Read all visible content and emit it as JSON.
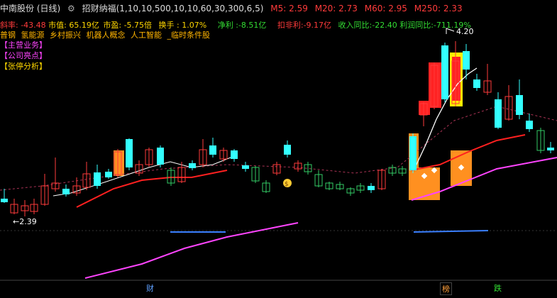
{
  "header": {
    "stock": "中南股份 (日线)",
    "gear_icon": "gear-icon",
    "indicator": "招财纳福(1,10,10,500,10,10,60,30,300,6,5)",
    "ma": [
      {
        "label": "M5: 2.59",
        "color": "#ff3b3b"
      },
      {
        "label": "M20: 2.73",
        "color": "#ff3b3b"
      },
      {
        "label": "M60: 2.95",
        "color": "#ff3b3b"
      },
      {
        "label": "M250: 2.33",
        "color": "#ff3b3b"
      }
    ]
  },
  "stats": [
    {
      "text": "斜率: -43.48",
      "color": "#ff3b3b"
    },
    {
      "text": "市值: 65.19亿",
      "color": "#ffd700"
    },
    {
      "text": "市盈: -5.75倍",
      "color": "#ffd700"
    },
    {
      "text": "换手 : 1.07%",
      "color": "#ffd700"
    },
    {
      "text": "净利 :-8.51亿",
      "color": "#33dd33"
    },
    {
      "text": "扣非利:-9.17亿",
      "color": "#ff3b3b"
    },
    {
      "text": "收入同比:-22.40",
      "color": "#33dd33"
    },
    {
      "text": "利润同比:-711.19%",
      "color": "#33dd33"
    }
  ],
  "concepts": [
    "普钢",
    "氢能源",
    "乡村振兴",
    "机器人概念",
    "人工智能",
    "_临时条件股"
  ],
  "links": [
    {
      "text": "【主营业务】",
      "color": "#ff44ff"
    },
    {
      "text": "【公司亮点】",
      "color": "#ff44ff"
    },
    {
      "text": "【张停分析】",
      "color": "#ffd700"
    }
  ],
  "price_labels": {
    "low": "←2.39",
    "high": "4.20"
  },
  "bottom_tags": [
    {
      "text": "财",
      "color": "#5fa0ff"
    },
    {
      "text": "榜",
      "color": "#ff9f3b"
    },
    {
      "text": "跌",
      "color": "#33dd33"
    }
  ],
  "coin_icon": "money-bag-icon"
}
